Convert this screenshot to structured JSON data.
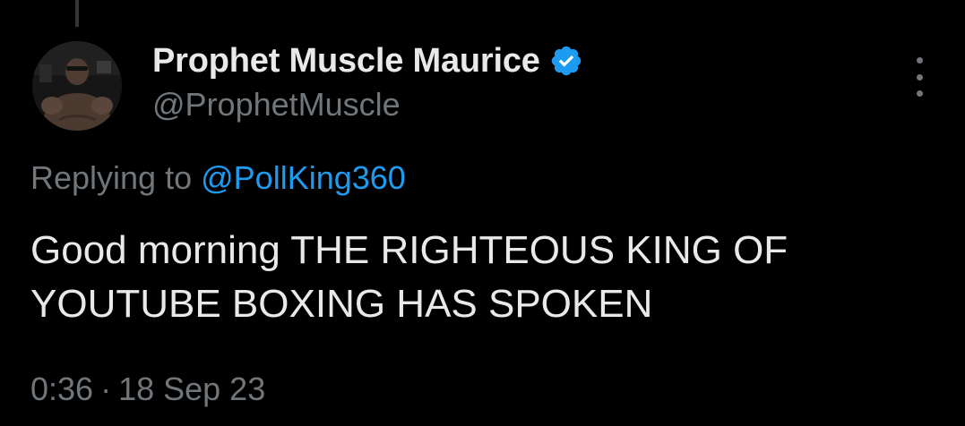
{
  "tweet": {
    "author": {
      "display_name": "Prophet Muscle Maurice",
      "handle": "@ProphetMuscle",
      "verified": true,
      "avatar_icon": "avatar-photo"
    },
    "reply_context": {
      "prefix": "Replying to",
      "mention": "@PollKing360"
    },
    "text": "Good morning THE RIGHTEOUS KING OF YOUTUBE BOXING HAS SPOKEN",
    "time": "0:36",
    "separator": "·",
    "date": "18 Sep 23"
  },
  "colors": {
    "background": "#000000",
    "primary_text": "#e7e9ea",
    "secondary_text": "#71767b",
    "accent": "#1d9bf0"
  },
  "icons": {
    "verified": "verified-badge-icon",
    "more": "more-options-icon"
  }
}
